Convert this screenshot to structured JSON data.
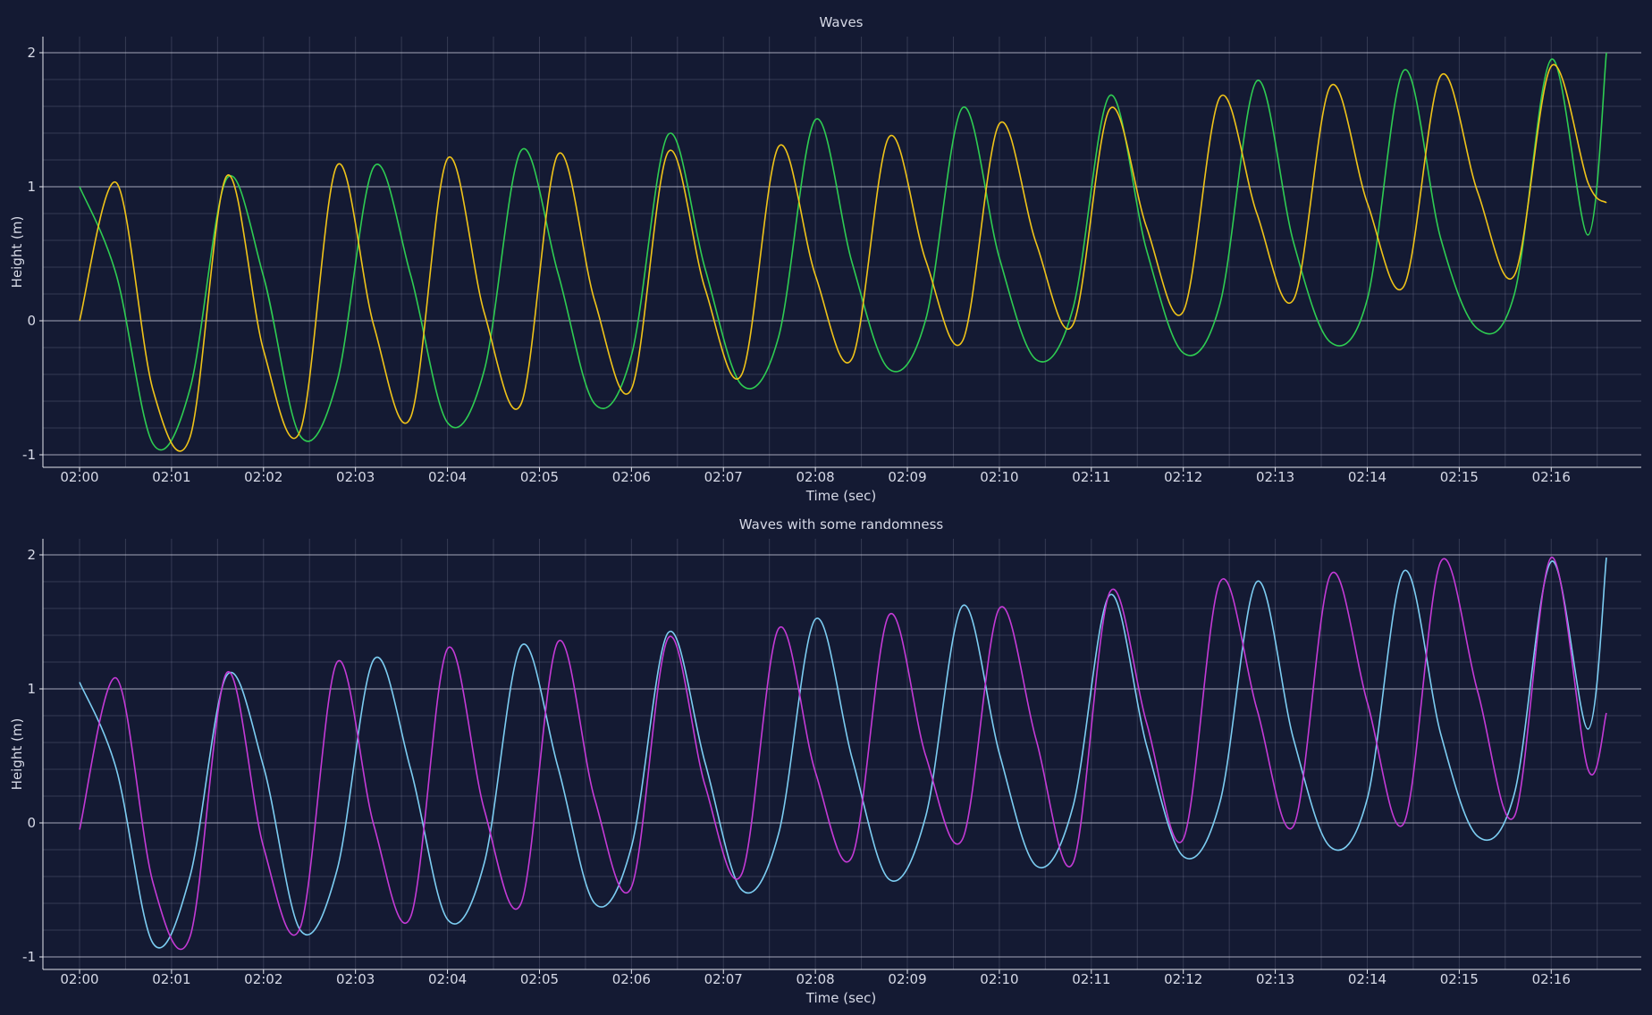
{
  "chart_data": [
    {
      "type": "line",
      "title": "Waves",
      "xlabel": "Time (sec)",
      "ylabel": "Height (m)",
      "xlim": [
        0,
        16.6
      ],
      "ylim": [
        -1,
        2
      ],
      "x_ticks": [
        "02:00",
        "02:01",
        "02:02",
        "02:03",
        "02:04",
        "02:05",
        "02:06",
        "02:07",
        "02:08",
        "02:09",
        "02:10",
        "02:11",
        "02:12",
        "02:13",
        "02:14",
        "02:15",
        "02:16"
      ],
      "y_ticks": [
        "2",
        "1",
        "0",
        "-1"
      ],
      "grid": true,
      "legend": "none",
      "x": [
        0,
        0.4,
        0.8,
        1.2,
        1.6,
        2.0,
        2.4,
        2.8,
        3.2,
        3.6,
        4.0,
        4.4,
        4.8,
        5.2,
        5.6,
        6.0,
        6.4,
        6.8,
        7.2,
        7.6,
        8.0,
        8.4,
        8.8,
        9.2,
        9.6,
        10.0,
        10.4,
        10.8,
        11.2,
        11.6,
        12.0,
        12.4,
        12.8,
        13.2,
        13.6,
        14.0,
        14.4,
        14.8,
        15.2,
        15.6,
        16.0,
        16.4,
        16.6
      ],
      "series": [
        {
          "color": "#2ecc52",
          "values": [
            1.0,
            0.34,
            -0.92,
            -0.51,
            1.06,
            0.33,
            -0.86,
            -0.45,
            1.15,
            0.34,
            -0.76,
            -0.37,
            1.27,
            0.36,
            -0.62,
            -0.26,
            1.39,
            0.39,
            -0.48,
            -0.12,
            1.5,
            0.43,
            -0.36,
            0.01,
            1.59,
            0.47,
            -0.29,
            0.09,
            1.68,
            0.53,
            -0.24,
            0.13,
            1.79,
            0.58,
            -0.16,
            0.16,
            1.87,
            0.61,
            -0.06,
            0.2,
            1.95,
            0.64,
            2.0
          ]
        },
        {
          "color": "#f0c419",
          "values": [
            0.0,
            1.03,
            -0.52,
            -0.87,
            1.08,
            -0.22,
            -0.82,
            1.16,
            -0.04,
            -0.72,
            1.21,
            0.06,
            -0.62,
            1.24,
            0.15,
            -0.51,
            1.26,
            0.24,
            -0.4,
            1.3,
            0.34,
            -0.28,
            1.37,
            0.45,
            -0.15,
            1.47,
            0.58,
            -0.03,
            1.58,
            0.7,
            0.07,
            1.67,
            0.8,
            0.16,
            1.75,
            0.88,
            0.26,
            1.83,
            0.96,
            0.34,
            1.9,
            1.03,
            0.88
          ]
        }
      ]
    },
    {
      "type": "line",
      "title": "Waves with some randomness",
      "xlabel": "Time (sec)",
      "ylabel": "Height (m)",
      "xlim": [
        0,
        16.6
      ],
      "ylim": [
        -1,
        2
      ],
      "x_ticks": [
        "02:00",
        "02:01",
        "02:02",
        "02:03",
        "02:04",
        "02:05",
        "02:06",
        "02:07",
        "02:08",
        "02:09",
        "02:10",
        "02:11",
        "02:12",
        "02:13",
        "02:14",
        "02:15",
        "02:16"
      ],
      "y_ticks": [
        "2",
        "1",
        "0",
        "-1"
      ],
      "grid": true,
      "legend": "none",
      "x": [
        0,
        0.4,
        0.8,
        1.2,
        1.6,
        2.0,
        2.4,
        2.8,
        3.2,
        3.6,
        4.0,
        4.4,
        4.8,
        5.2,
        5.6,
        6.0,
        6.4,
        6.8,
        7.2,
        7.6,
        8.0,
        8.4,
        8.8,
        9.2,
        9.6,
        10.0,
        10.4,
        10.8,
        11.2,
        11.6,
        12.0,
        12.4,
        12.8,
        13.2,
        13.6,
        14.0,
        14.4,
        14.8,
        15.2,
        15.6,
        16.0,
        16.4,
        16.6
      ],
      "series": [
        {
          "color": "#7ccdf2",
          "values": [
            1.05,
            0.4,
            -0.9,
            -0.4,
            1.1,
            0.42,
            -0.8,
            -0.35,
            1.22,
            0.4,
            -0.72,
            -0.3,
            1.32,
            0.42,
            -0.6,
            -0.18,
            1.42,
            0.45,
            -0.5,
            -0.08,
            1.52,
            0.48,
            -0.42,
            0.05,
            1.62,
            0.52,
            -0.32,
            0.12,
            1.7,
            0.58,
            -0.25,
            0.16,
            1.8,
            0.62,
            -0.18,
            0.18,
            1.88,
            0.66,
            -0.1,
            0.22,
            1.95,
            0.7,
            1.98
          ]
        },
        {
          "color": "#c43ad6",
          "values": [
            -0.05,
            1.08,
            -0.45,
            -0.85,
            1.12,
            -0.18,
            -0.78,
            1.2,
            -0.02,
            -0.7,
            1.3,
            0.1,
            -0.6,
            1.35,
            0.18,
            -0.48,
            1.38,
            0.28,
            -0.38,
            1.45,
            0.38,
            -0.25,
            1.55,
            0.5,
            -0.12,
            1.6,
            0.62,
            -0.3,
            1.72,
            0.75,
            -0.12,
            1.8,
            0.85,
            -0.02,
            1.85,
            0.9,
            0.0,
            1.95,
            0.98,
            0.05,
            1.98,
            0.4,
            0.82
          ]
        }
      ]
    }
  ]
}
